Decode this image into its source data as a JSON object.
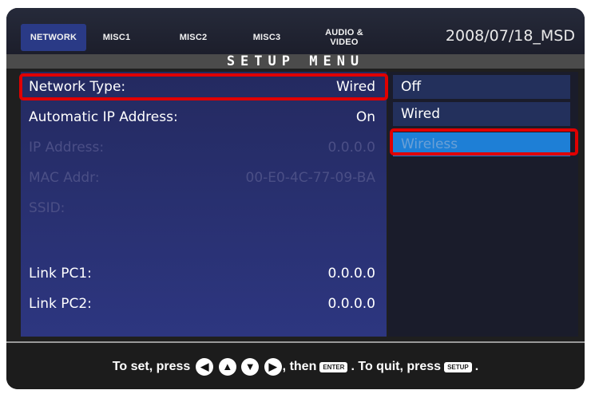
{
  "tabs": [
    "NETWORK",
    "MISC1",
    "MISC2",
    "MISC3",
    "AUDIO &",
    "VIDEO"
  ],
  "date_label": "2008/07/18_MSD",
  "title": "SETUP MENU",
  "settings": {
    "network_type": {
      "label": "Network Type:",
      "value": "Wired"
    },
    "auto_ip": {
      "label": "Automatic IP Address:",
      "value": "On"
    },
    "ip_address": {
      "label": "IP Address:",
      "value": "0.0.0.0"
    },
    "mac_addr": {
      "label": "MAC Addr:",
      "value": "00-E0-4C-77-09-BA"
    },
    "ssid": {
      "label": "SSID:",
      "value": ""
    },
    "link_pc1": {
      "label": "Link PC1:",
      "value": "0.0.0.0"
    },
    "link_pc2": {
      "label": "Link PC2:",
      "value": "0.0.0.0"
    }
  },
  "options": [
    "Off",
    "Wired",
    "Wireless"
  ],
  "footer": {
    "part1": "To set, press",
    "part2": ", then",
    "enter_label": "ENTER",
    "part3": ". To quit, press",
    "setup_label": "SETUP",
    "part4": "."
  },
  "arrow_icons": [
    "◀",
    "▲",
    "▼",
    "▶"
  ],
  "colors": {
    "highlight": "#e00000",
    "selected_option": "#1e7fd6",
    "active_tab": "#2a3a86"
  }
}
